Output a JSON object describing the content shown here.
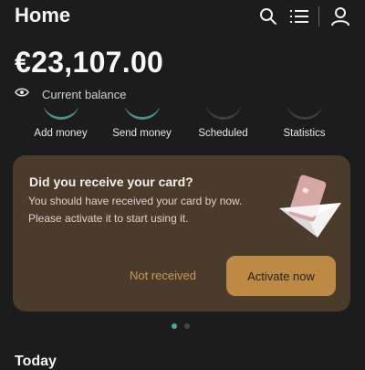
{
  "header": {
    "title": "Home",
    "icons": [
      "search-icon",
      "list-icon",
      "profile-icon"
    ]
  },
  "balance": {
    "amount": "€23,107.00",
    "label": "Current balance",
    "icon": "eye-icon"
  },
  "actions": [
    {
      "label": "Add money",
      "color": "#4d8e8a"
    },
    {
      "label": "Send money",
      "color": "#4d8e8a"
    },
    {
      "label": "Scheduled",
      "color": "#3e3e3e"
    },
    {
      "label": "Statistics",
      "color": "#3e3e3e"
    }
  ],
  "card_prompt": {
    "title": "Did you receive your card?",
    "line1": "You should have received your card by now.",
    "line2": "Please activate it to start using it.",
    "secondary_button": "Not received",
    "primary_button": "Activate now",
    "illustration": "card-envelope-icon"
  },
  "pagination": {
    "active_color": "#4da6a3",
    "inactive_color": "#3a4a4a"
  },
  "section": {
    "title": "Today"
  },
  "colors": {
    "background": "#1c1c1c",
    "card_background": "#4b3b2b",
    "accent": "#bd8a46"
  }
}
